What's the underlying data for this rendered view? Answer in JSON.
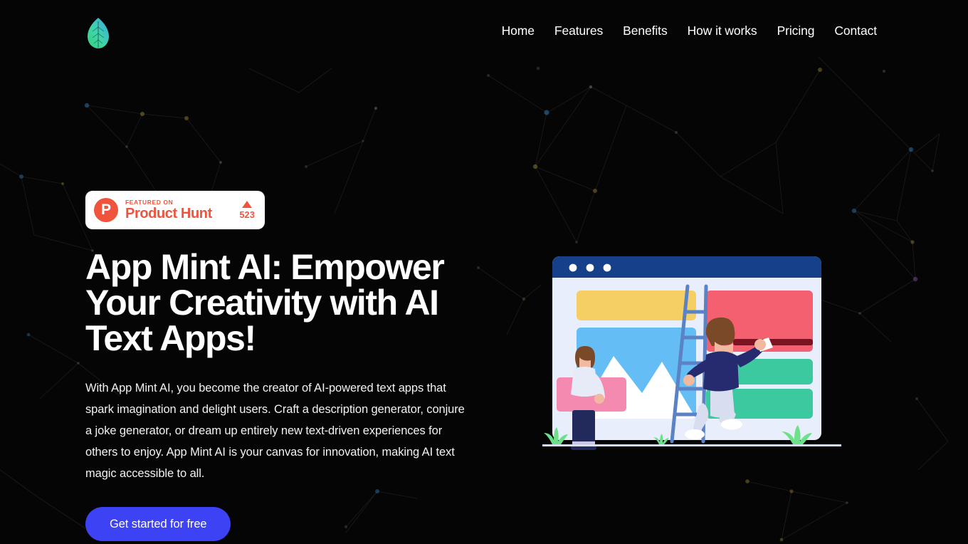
{
  "brand": {
    "logo_icon": "leaf-icon",
    "logo_gradient_from": "#4ade80",
    "logo_gradient_to": "#38bdf8"
  },
  "nav": {
    "items": [
      {
        "label": "Home"
      },
      {
        "label": "Features"
      },
      {
        "label": "Benefits"
      },
      {
        "label": "How it works"
      },
      {
        "label": "Pricing"
      },
      {
        "label": "Contact"
      }
    ]
  },
  "badge": {
    "logo_letter": "P",
    "featured_label": "FEATURED ON",
    "product_name": "Product Hunt",
    "upvote_icon": "triangle-up-icon",
    "upvote_count": "523",
    "accent_color": "#f0543c",
    "background_color": "#ffffff"
  },
  "hero": {
    "title": "App Mint AI: Empower Your Creativity with AI Text Apps!",
    "subtitle": "With App Mint AI, you become the creator of AI-powered text apps that spark imagination and delight users. Craft a description generator, conjure a joke generator, or dream up entirely new text-driven experiences for others to enjoy. App Mint AI is your canvas for innovation, making AI text magic accessible to all.",
    "cta_label": "Get started for free",
    "cta_color": "#3d42f5",
    "title_color": "#ffffff",
    "subtitle_color": "#f2f2f2"
  },
  "illustration": {
    "name": "website-builder-illustration",
    "description": "Browser window mockup with two people building a web page, one standing on a ladder",
    "window_titlebar_color": "#17408b",
    "window_body_color": "#e8eefc",
    "card_yellow": "#f5cf63",
    "card_red": "#f4606f",
    "card_green": "#3dc9a0",
    "card_blue": "#64bdf5",
    "card_pink": "#f58ab0",
    "ladder_color": "#5b82c4",
    "grass_color": "#6de08a",
    "dot_count": "3"
  },
  "background": {
    "color": "#050505",
    "pattern": "constellation-network",
    "node_colors": [
      "#2f6d9e",
      "#8a7a2e",
      "#555555",
      "#6b4a8a"
    ]
  }
}
